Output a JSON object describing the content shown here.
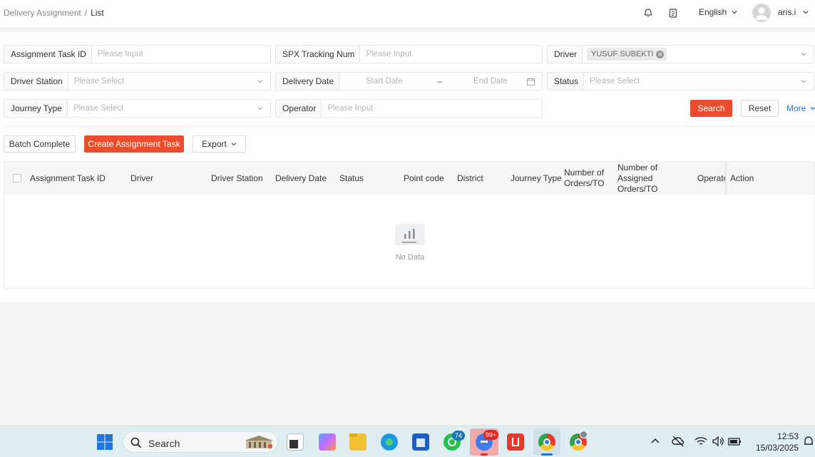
{
  "breadcrumb": {
    "parent": "Delivery Assignment",
    "separator": "/",
    "current": "List"
  },
  "header": {
    "language": "English",
    "username": "aris.i"
  },
  "filters": {
    "assignment_task_id": {
      "label": "Assignment Task ID",
      "placeholder": "Please Input"
    },
    "spx_tracking_num": {
      "label": "SPX Tracking Num",
      "placeholder": "Please Input"
    },
    "driver": {
      "label": "Driver",
      "selected": "YUSUF SUBEKTI"
    },
    "driver_station": {
      "label": "Driver Station",
      "placeholder": "Please Select"
    },
    "delivery_date": {
      "label": "Delivery Date",
      "start_placeholder": "Start Date",
      "range_separator": "–",
      "end_placeholder": "End Date"
    },
    "status": {
      "label": "Status",
      "placeholder": "Please Select"
    },
    "journey_type": {
      "label": "Journey Type",
      "placeholder": "Please Select"
    },
    "operator": {
      "label": "Operator",
      "placeholder": "Please Input"
    }
  },
  "actions": {
    "search": "Search",
    "reset": "Reset",
    "more": "More"
  },
  "toolbar": {
    "batch_complete": "Batch Complete",
    "create_task": "Create Assignment Task",
    "export": "Export"
  },
  "table": {
    "columns": [
      "Assignment Task ID",
      "Driver",
      "Driver Station",
      "Delivery Date",
      "Status",
      "Point code",
      "District",
      "Journey Type",
      "Number of Orders/TO",
      "Number of Assigned Orders/TO",
      "Operator",
      "Action"
    ],
    "empty_text": "No Data"
  },
  "taskbar": {
    "search_label": "Search",
    "whatsapp_badge": "74",
    "messenger_badge": "99+",
    "time": "12:53",
    "date": "15/03/2025"
  },
  "colors": {
    "primary": "#ee4d2d",
    "link": "#2673dd",
    "header_bg": "#f6f6f6"
  }
}
